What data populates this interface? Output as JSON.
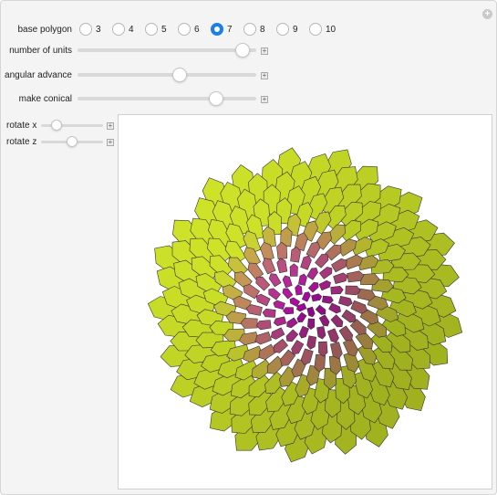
{
  "controls": {
    "base_polygon": {
      "label": "base polygon",
      "options": [
        "3",
        "4",
        "5",
        "6",
        "7",
        "8",
        "9",
        "10"
      ],
      "selected": "7"
    },
    "number_of_units": {
      "label": "number of units",
      "value": 0.96
    },
    "angular_advance": {
      "label": "angular advance",
      "value": 0.58
    },
    "make_conical": {
      "label": "make conical",
      "value": 0.8
    },
    "rotate_x": {
      "label": "rotate x",
      "value": 0.2
    },
    "rotate_z": {
      "label": "rotate z",
      "value": 0.5
    }
  },
  "icons": {
    "corner": "plus-circle-icon",
    "slider_expand": "plus-box-icon"
  },
  "colors": {
    "accent": "#1a7df0",
    "petal_outer": "#d4e81e",
    "petal_center": "#b300b0"
  }
}
